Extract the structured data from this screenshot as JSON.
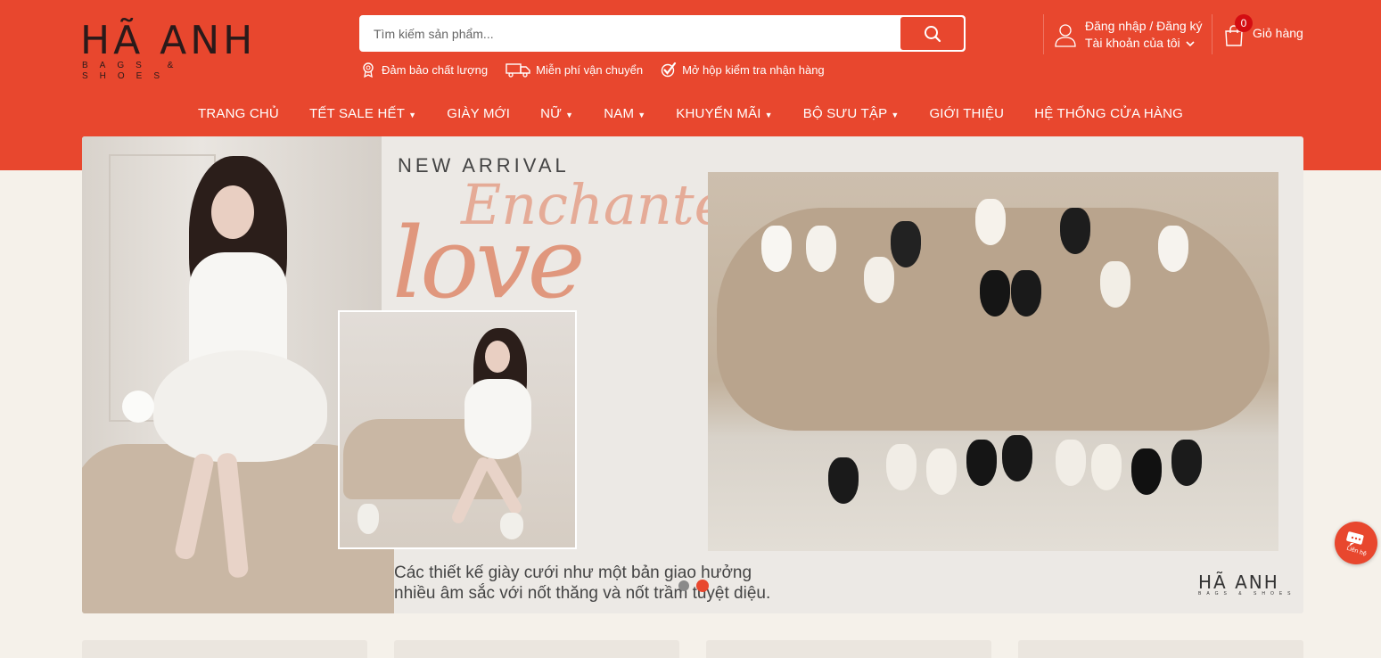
{
  "brand": {
    "name": "HÃ ANH",
    "tagline": "BAGS & SHOES"
  },
  "search": {
    "placeholder": "Tìm kiếm sản phẩm...",
    "icon": "search-icon"
  },
  "features": [
    {
      "label": "Đảm bảo chất lượng",
      "icon": "medal-icon"
    },
    {
      "label": "Miễn phí vận chuyển",
      "icon": "truck-icon"
    },
    {
      "label": "Mở hộp kiểm tra nhận hàng",
      "icon": "check-icon"
    }
  ],
  "account": {
    "line1": "Đăng nhập / Đăng ký",
    "line2": "Tài khoản của tôi",
    "icon": "user-icon"
  },
  "cart": {
    "count": "0",
    "label": "Giỏ hàng",
    "icon": "bag-icon"
  },
  "nav": [
    {
      "label": "TRANG CHỦ",
      "dropdown": false
    },
    {
      "label": "TẾT SALE HẾT",
      "dropdown": true
    },
    {
      "label": "GIÀY MỚI",
      "dropdown": false
    },
    {
      "label": "NỮ",
      "dropdown": true
    },
    {
      "label": "NAM",
      "dropdown": true
    },
    {
      "label": "KHUYẾN MÃI",
      "dropdown": true
    },
    {
      "label": "BỘ SƯU TẬP",
      "dropdown": true
    },
    {
      "label": "GIỚI THIỆU",
      "dropdown": false
    },
    {
      "label": "HỆ THỐNG CỬA HÀNG",
      "dropdown": false
    }
  ],
  "banner": {
    "heading": "NEW ARRIVAL",
    "script": "Enchanted",
    "script_big": "love",
    "caption_line1": "Các thiết kế giày cưới như một bản giao hưởng",
    "caption_line2": "nhiều âm sắc với nốt thăng và nốt trầm tuyệt diệu.",
    "logo_main": "HÃ ANH",
    "logo_sub": "BAGS & SHOES",
    "slides": 2,
    "active_slide": 2
  },
  "chat": {
    "label": "Liên hệ",
    "icon": "chat-icon"
  },
  "colors": {
    "brand": "#e8472e",
    "badge": "#d40d12",
    "page_bg": "#f5f1ea"
  }
}
